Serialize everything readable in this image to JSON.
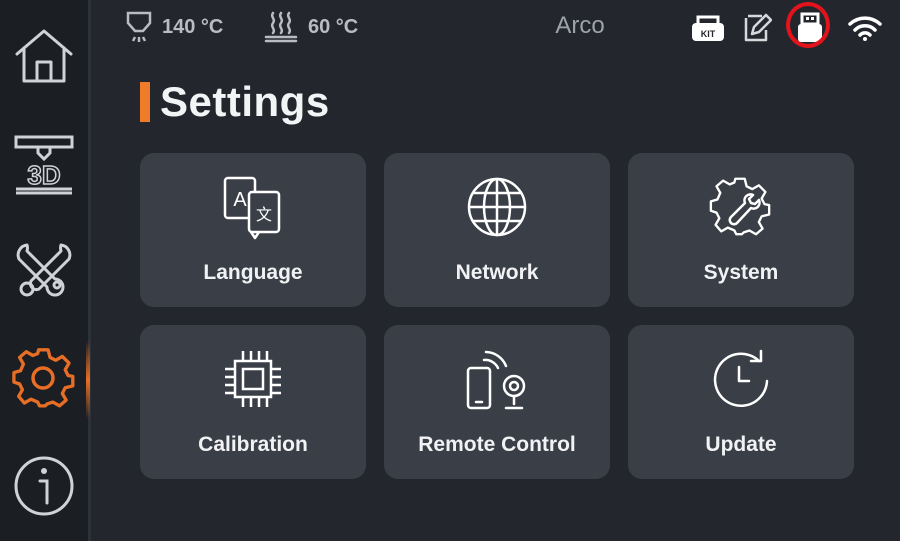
{
  "topbar": {
    "nozzle_temp": "140 °C",
    "bed_temp": "60 °C",
    "printer_name": "Arco",
    "status_icons": [
      "kit-icon",
      "edit-icon",
      "usb-icon",
      "wifi-icon"
    ],
    "kit_badge": "KIT"
  },
  "sidebar": {
    "items": [
      {
        "name": "home",
        "icon": "home-icon"
      },
      {
        "name": "print-3d",
        "icon": "3d-printer-icon",
        "label": "3D"
      },
      {
        "name": "tools",
        "icon": "tools-icon"
      },
      {
        "name": "settings",
        "icon": "gear-icon",
        "active": true
      },
      {
        "name": "info",
        "icon": "info-icon"
      }
    ],
    "active_color": "#e86e25"
  },
  "page": {
    "title": "Settings",
    "accent_color": "#f07b2b"
  },
  "cards": [
    {
      "label": "Language",
      "icon": "language-icon"
    },
    {
      "label": "Network",
      "icon": "globe-icon"
    },
    {
      "label": "System",
      "icon": "system-gear-icon"
    },
    {
      "label": "Calibration",
      "icon": "chip-icon"
    },
    {
      "label": "Remote Control",
      "icon": "remote-control-icon"
    },
    {
      "label": "Update",
      "icon": "update-icon"
    }
  ],
  "colors": {
    "background": "#23272d",
    "sidebar": "#1b1e23",
    "card": "#3a3f47",
    "highlight_circle": "#e3131b"
  }
}
